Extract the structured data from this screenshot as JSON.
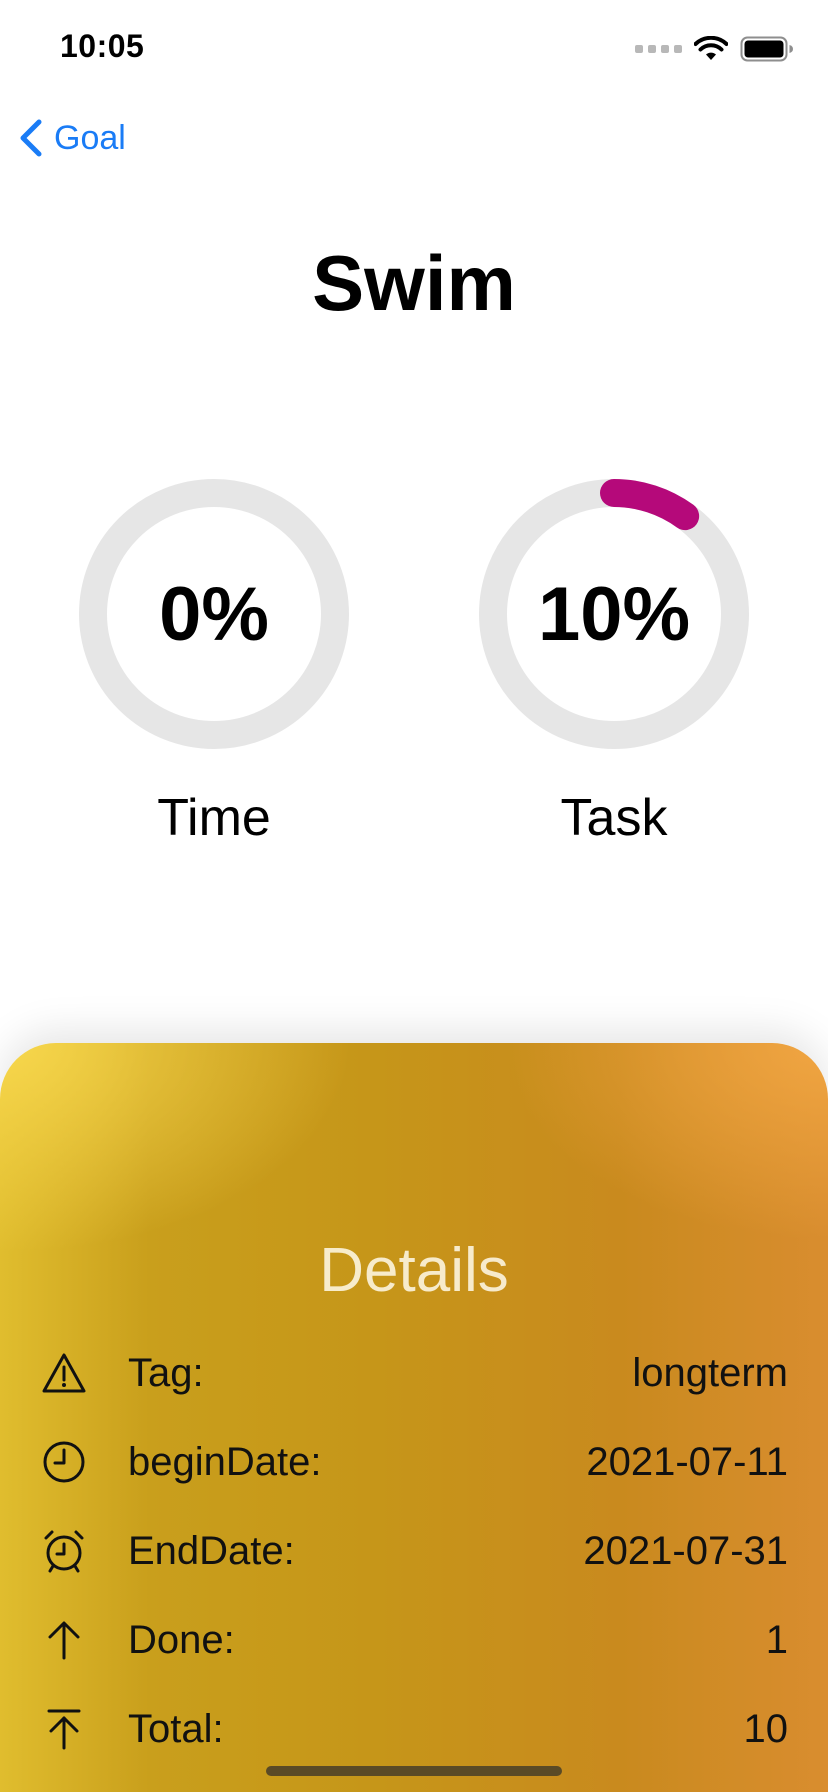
{
  "status_bar": {
    "time": "10:05",
    "icons": [
      "cellular-signal-icon",
      "wifi-icon",
      "battery-icon"
    ]
  },
  "nav": {
    "back_label": "Goal",
    "back_icon": "chevron-left-icon",
    "accent_color": "#1a7cf6"
  },
  "title": "Swim",
  "rings": {
    "time": {
      "value_text": "0%",
      "label": "Time",
      "progress": 0.0,
      "color": "#b5097a",
      "track_color": "#e6e6e6"
    },
    "task": {
      "value_text": "10%",
      "label": "Task",
      "progress": 0.1,
      "color": "#b5097a",
      "track_color": "#e6e6e6"
    }
  },
  "details": {
    "title": "Details",
    "rows": [
      {
        "icon": "warning-triangle-icon",
        "label": "Tag:",
        "value": "longterm"
      },
      {
        "icon": "clock-icon",
        "label": "beginDate:",
        "value": "2021-07-11"
      },
      {
        "icon": "alarm-clock-icon",
        "label": "EndDate:",
        "value": "2021-07-31"
      },
      {
        "icon": "arrow-up-icon",
        "label": "Done:",
        "value": "1"
      },
      {
        "icon": "arrow-up-to-line-icon",
        "label": "Total:",
        "value": "10"
      }
    ]
  }
}
